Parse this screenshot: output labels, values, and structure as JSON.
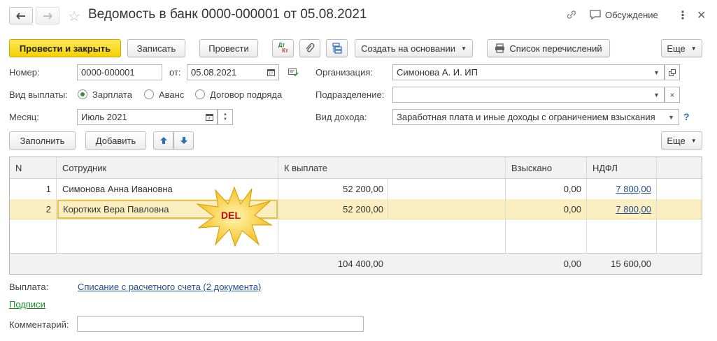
{
  "window": {
    "title": "Ведомость в банк 0000-000001 от 05.08.2021",
    "discussion_label": "Обсуждение"
  },
  "toolbar": {
    "post_and_close": "Провести и закрыть",
    "save": "Записать",
    "post": "Провести",
    "dtkt_top": "Дт",
    "dtkt_bottom": "Кт",
    "create_based_on": "Создать на основании",
    "transfer_list": "Список перечислений",
    "more": "Еще"
  },
  "form": {
    "number_label": "Номер:",
    "number_value": "0000-000001",
    "date_label": "от:",
    "date_value": "05.08.2021",
    "org_label": "Организация:",
    "org_value": "Симонова А. И. ИП",
    "payment_type_label": "Вид выплаты:",
    "payment_types": [
      "Зарплата",
      "Аванс",
      "Договор подряда"
    ],
    "payment_type_selected": "Зарплата",
    "division_label": "Подразделение:",
    "division_value": "",
    "month_label": "Месяц:",
    "month_value": "Июль 2021",
    "income_type_label": "Вид дохода:",
    "income_type_value": "Заработная плата и иные доходы с ограничением взыскания",
    "help": "?"
  },
  "table_toolbar": {
    "fill": "Заполнить",
    "add": "Добавить",
    "more": "Еще"
  },
  "table": {
    "columns": [
      "N",
      "Сотрудник",
      "К выплате",
      "Взыскано",
      "НДФЛ"
    ],
    "rows": [
      {
        "n": "1",
        "employee": "Симонова Анна Ивановна",
        "to_pay": "52 200,00",
        "recovered": "0,00",
        "ndfl": "7 800,00"
      },
      {
        "n": "2",
        "employee": "Коротких Вера Павловна",
        "to_pay": "52 200,00",
        "recovered": "0,00",
        "ndfl": "7 800,00"
      }
    ],
    "totals": {
      "to_pay": "104 400,00",
      "recovered": "0,00",
      "ndfl": "15 600,00"
    },
    "selected_row": 2
  },
  "callout": {
    "text": "DEL",
    "color": "#d40000",
    "fill": "#ffd23a"
  },
  "footer": {
    "payment_label": "Выплата:",
    "payment_link": "Списание с расчетного счета (2 документа)",
    "signatures_link": "Подписи",
    "comment_label": "Комментарий:",
    "comment_value": ""
  },
  "colors": {
    "accent_yellow": "#f5d200",
    "link_blue": "#1f4e96",
    "link_green": "#168c2b",
    "selection": "#fbefc2"
  }
}
